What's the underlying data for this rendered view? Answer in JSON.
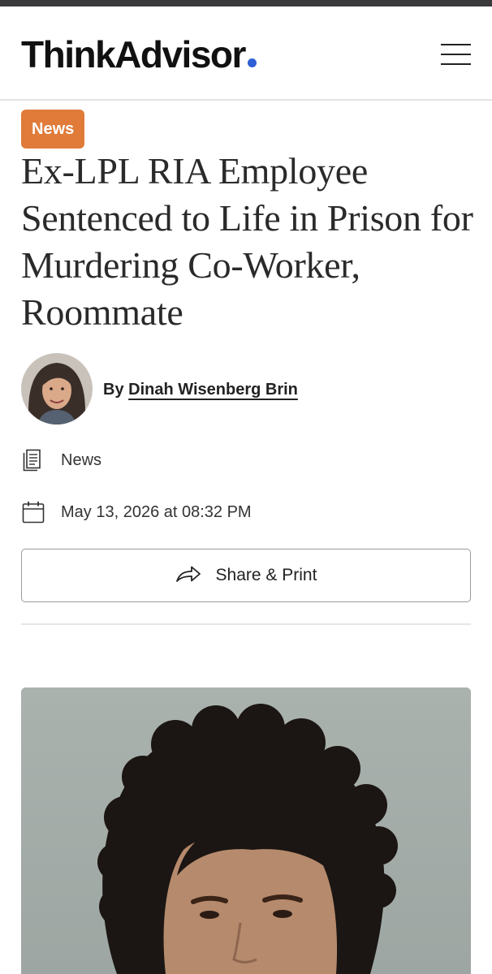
{
  "brand": {
    "name": "ThinkAdvisor",
    "dot_color": "#2f5fd6"
  },
  "header": {
    "menu_icon": "hamburger-menu-icon"
  },
  "article": {
    "category_badge": "News",
    "badge_color": "#e07b39",
    "title": "Ex-LPL RIA Employee Sentenced to Life in Prison for Murdering Co-Worker, Roommate",
    "byline_prefix": "By",
    "author": "Dinah Wisenberg Brin",
    "section_icon": "document-icon",
    "section": "News",
    "date_icon": "calendar-icon",
    "published": "May 13, 2026 at 08:32 PM",
    "share_icon": "share-arrow-icon",
    "share_label": "Share & Print"
  }
}
